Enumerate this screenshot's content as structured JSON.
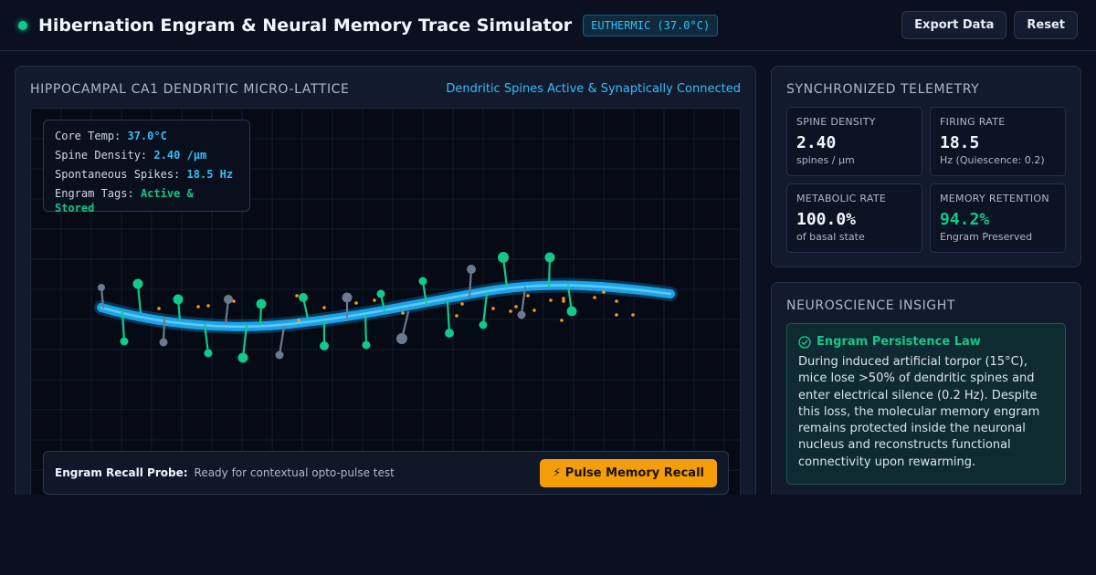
{
  "header": {
    "title": "Hibernation Engram & Neural Memory Trace Simulator",
    "temp_badge": "EUTHERMIC (37.0°C)",
    "export_label": "Export Data",
    "reset_label": "Reset",
    "status_color": "#10c98a"
  },
  "main": {
    "title": "HIPPOCAMPAL CA1 DENDRITIC MICRO-LATTICE",
    "status": "Dendritic Spines Active & Synaptically Connected",
    "readout": {
      "core_temp_label": "Core Temp:",
      "core_temp": "37.0°C",
      "spine_density_label": "Spine Density:",
      "spine_density": "2.40 /µm",
      "spikes_label": "Spontaneous Spikes:",
      "spikes": "18.5 Hz",
      "engram_label": "Engram Tags:",
      "engram": "Active & Stored"
    },
    "probe": {
      "label": "Engram Recall Probe:",
      "status": "Ready for contextual opto-pulse test",
      "button": "⚡ Pulse Memory Recall"
    }
  },
  "telemetry": {
    "title": "SYNCHRONIZED TELEMETRY",
    "stats": [
      {
        "label": "SPINE DENSITY",
        "value": "2.40",
        "sub": "spines / µm"
      },
      {
        "label": "FIRING RATE",
        "value": "18.5",
        "sub": "Hz (Quiescence: 0.2)"
      },
      {
        "label": "METABOLIC RATE",
        "value": "100.0%",
        "sub": "of basal state"
      },
      {
        "label": "MEMORY RETENTION",
        "value": "94.2%",
        "sub": "Engram Preserved"
      }
    ]
  },
  "insight": {
    "title": "NEUROSCIENCE INSIGHT",
    "heading": "Engram Persistence Law",
    "body": "During induced artificial torpor (15°C), mice lose >50% of dendritic spines and enter electrical silence (0.2 Hz). Despite this loss, the molecular memory engram remains protected inside the neuronal nucleus and reconstructs functional connectivity upon rewarming."
  },
  "colors": {
    "accent": "#38bdf8",
    "active_spine": "#10c98a",
    "inactive_spine": "#6b7a90",
    "vesicle": "#f59e0b",
    "warning": "#f59e0b"
  }
}
